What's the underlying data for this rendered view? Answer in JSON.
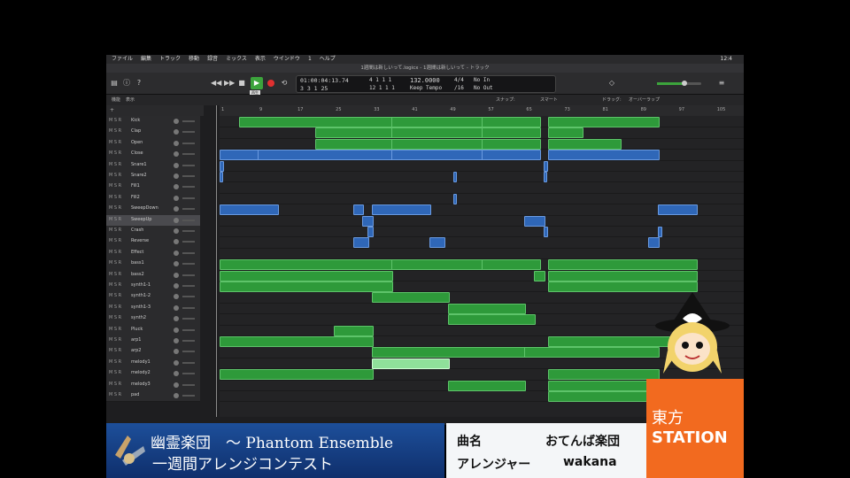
{
  "menubar": {
    "items": [
      "ファイル",
      "編集",
      "トラック",
      "移動",
      "録音",
      "ミックス",
      "表示",
      "ウインドウ",
      "1",
      "ヘルプ"
    ],
    "clock": "12:4"
  },
  "window_title": "1週間は新しいって.logicx - 1週間は新しいって - トラック",
  "transport": {
    "play_tooltip": "再生",
    "time_hms": "01:00:04:13.74",
    "time_bars": "3  3  1   25",
    "pos_a": "4  1  1    1",
    "pos_b": "12  1  1    1",
    "tempo": "132.0000",
    "tempo_mode": "Keep Tempo",
    "signature": "4/4",
    "division": "/16",
    "in": "No In",
    "out": "No Out"
  },
  "subbar": {
    "edit": "機能",
    "view": "表示",
    "snap_label": "スナップ:",
    "snap_value": "スマート",
    "drag_label": "ドラッグ:",
    "drag_value": "オーバーラップ"
  },
  "ruler": [
    "1",
    "9",
    "17",
    "25",
    "33",
    "41",
    "49",
    "57",
    "65",
    "73",
    "81",
    "89",
    "97",
    "105"
  ],
  "tracks": [
    {
      "name": "Kick"
    },
    {
      "name": "Clap"
    },
    {
      "name": "Open"
    },
    {
      "name": "Close"
    },
    {
      "name": "Snare1"
    },
    {
      "name": "Snare2"
    },
    {
      "name": "Fill1"
    },
    {
      "name": "Fill2"
    },
    {
      "name": "SweepDown"
    },
    {
      "name": "SweepUp"
    },
    {
      "name": "Crash"
    },
    {
      "name": "Reverse"
    },
    {
      "name": "Effect"
    },
    {
      "name": "bass1"
    },
    {
      "name": "bass2"
    },
    {
      "name": "synth1-1"
    },
    {
      "name": "synth1-2"
    },
    {
      "name": "synth1-3"
    },
    {
      "name": "synth2"
    },
    {
      "name": "Pluck"
    },
    {
      "name": "arp1"
    },
    {
      "name": "arp2"
    },
    {
      "name": "melody1"
    },
    {
      "name": "melody2"
    },
    {
      "name": "melody3"
    },
    {
      "name": "pad"
    }
  ],
  "track_buttons": "M S R",
  "regions": [
    {
      "t": 0,
      "s": 5,
      "e": 37,
      "c": "g"
    },
    {
      "t": 0,
      "s": 37,
      "e": 56,
      "c": "g"
    },
    {
      "t": 0,
      "s": 56,
      "e": 68,
      "c": "g"
    },
    {
      "t": 0,
      "s": 70,
      "e": 93,
      "c": "g"
    },
    {
      "t": 1,
      "s": 21,
      "e": 37,
      "c": "g"
    },
    {
      "t": 1,
      "s": 37,
      "e": 56,
      "c": "g"
    },
    {
      "t": 1,
      "s": 56,
      "e": 68,
      "c": "g"
    },
    {
      "t": 1,
      "s": 70,
      "e": 77,
      "c": "g"
    },
    {
      "t": 2,
      "s": 21,
      "e": 37,
      "c": "g"
    },
    {
      "t": 2,
      "s": 37,
      "e": 56,
      "c": "g"
    },
    {
      "t": 2,
      "s": 56,
      "e": 68,
      "c": "g"
    },
    {
      "t": 2,
      "s": 70,
      "e": 85,
      "c": "g"
    },
    {
      "t": 3,
      "s": 1,
      "e": 9,
      "c": "b"
    },
    {
      "t": 3,
      "s": 9,
      "e": 37,
      "c": "b"
    },
    {
      "t": 3,
      "s": 37,
      "e": 56,
      "c": "b"
    },
    {
      "t": 3,
      "s": 56,
      "e": 68,
      "c": "b"
    },
    {
      "t": 3,
      "s": 70,
      "e": 93,
      "c": "b"
    },
    {
      "t": 4,
      "s": 1,
      "e": 1.6,
      "c": "b"
    },
    {
      "t": 4,
      "s": 69,
      "e": 69.6,
      "c": "b"
    },
    {
      "t": 5,
      "s": 1,
      "e": 1.4,
      "c": "b"
    },
    {
      "t": 5,
      "s": 50,
      "e": 50.4,
      "c": "b"
    },
    {
      "t": 5,
      "s": 69,
      "e": 69.4,
      "c": "b"
    },
    {
      "t": 7,
      "s": 50,
      "e": 50.4,
      "c": "b"
    },
    {
      "t": 8,
      "s": 1,
      "e": 13,
      "c": "b"
    },
    {
      "t": 8,
      "s": 29,
      "e": 31,
      "c": "b"
    },
    {
      "t": 8,
      "s": 33,
      "e": 45,
      "c": "b"
    },
    {
      "t": 8,
      "s": 93,
      "e": 101,
      "c": "b"
    },
    {
      "t": 9,
      "s": 31,
      "e": 33,
      "c": "b"
    },
    {
      "t": 9,
      "s": 65,
      "e": 69,
      "c": "b"
    },
    {
      "t": 10,
      "s": 32,
      "e": 33,
      "c": "b"
    },
    {
      "t": 10,
      "s": 69,
      "e": 69.6,
      "c": "b"
    },
    {
      "t": 10,
      "s": 93,
      "e": 93.6,
      "c": "b"
    },
    {
      "t": 11,
      "s": 29,
      "e": 32,
      "c": "b"
    },
    {
      "t": 11,
      "s": 45,
      "e": 48,
      "c": "b"
    },
    {
      "t": 11,
      "s": 91,
      "e": 93,
      "c": "b"
    },
    {
      "t": 13,
      "s": 1,
      "e": 37,
      "c": "g"
    },
    {
      "t": 13,
      "s": 37,
      "e": 56,
      "c": "g"
    },
    {
      "t": 13,
      "s": 56,
      "e": 68,
      "c": "g"
    },
    {
      "t": 13,
      "s": 70,
      "e": 101,
      "c": "g"
    },
    {
      "t": 14,
      "s": 1,
      "e": 37,
      "c": "g"
    },
    {
      "t": 14,
      "s": 67,
      "e": 69,
      "c": "g"
    },
    {
      "t": 14,
      "s": 70,
      "e": 101,
      "c": "g"
    },
    {
      "t": 15,
      "s": 1,
      "e": 37,
      "c": "g"
    },
    {
      "t": 15,
      "s": 70,
      "e": 101,
      "c": "g"
    },
    {
      "t": 16,
      "s": 33,
      "e": 49,
      "c": "g"
    },
    {
      "t": 17,
      "s": 49,
      "e": 65,
      "c": "g"
    },
    {
      "t": 18,
      "s": 49,
      "e": 67,
      "c": "g"
    },
    {
      "t": 19,
      "s": 25,
      "e": 33,
      "c": "g"
    },
    {
      "t": 20,
      "s": 1,
      "e": 33,
      "c": "g"
    },
    {
      "t": 20,
      "s": 70,
      "e": 101,
      "c": "g"
    },
    {
      "t": 21,
      "s": 33,
      "e": 65,
      "c": "g"
    },
    {
      "t": 21,
      "s": 65,
      "e": 93,
      "c": "g"
    },
    {
      "t": 22,
      "s": 33,
      "e": 49,
      "c": "lg"
    },
    {
      "t": 23,
      "s": 1,
      "e": 33,
      "c": "g"
    },
    {
      "t": 23,
      "s": 70,
      "e": 93,
      "c": "g"
    },
    {
      "t": 24,
      "s": 49,
      "e": 65,
      "c": "g"
    },
    {
      "t": 24,
      "s": 70,
      "e": 93,
      "c": "g"
    },
    {
      "t": 25,
      "s": 70,
      "e": 93,
      "c": "g"
    }
  ],
  "overlay": {
    "title": "幽霊楽団　～ Phantom Ensemble",
    "subtitle": "一週間アレンジコンテスト",
    "song_label": "曲名",
    "song_value": "おてんば楽団",
    "arranger_label": "アレンジャー",
    "arranger_value": "wakana",
    "station_line1": "東方",
    "station_line2": "STATION"
  }
}
